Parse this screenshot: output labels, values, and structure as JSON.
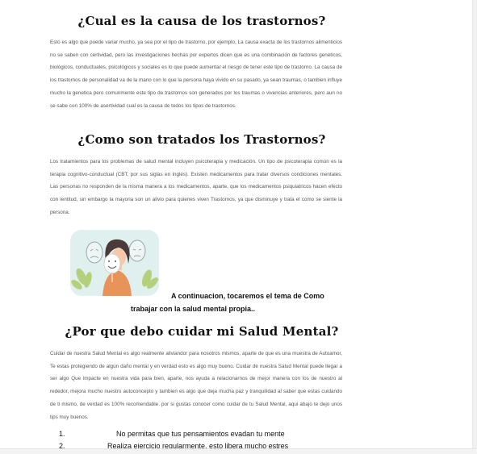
{
  "sections": [
    {
      "heading": "¿Cual es la causa de los trastornos?",
      "paragraph": "Esto es algo que puede variar mucho, ya sea por el tipo de trastorno, por ejemplo, La causa exacta de los trastornos alimenticios no se saben con certividad, pero las investigaciones hechas por expertos dicen que es una combinación de factores genéticos, biológicos, conductuales, psicológicos y sociales es lo que puede aumentar el riesgo de tener este tipo de trastorno. La causa de los trastornos de personalidad va de la mano con lo que la persona haya vivido en su pasado, ya sean traumas, o tambien influye mucho la genetica pero comunmente este tipo de trastornos son generados por los traumas o vivencias anteriores, pero aun no se sabe con 100% de asertividad cual es la causa de todos los tipos de trastornos."
    },
    {
      "heading": "¿Como son tratados los Trastornos?",
      "paragraph": "Los tratamientos para los problemas de salud mental incluyen psicoterapia y medicación. Un tipo de psicoterapia común es la terapia cognitivo-conductual (CBT, por sus siglas en inglés). Existen medicamentos para tratar diversos condiciones mentales. Las personas no responden de la misma manera a los medicamentos, aparte, que los medicamentos psiquiatricos hacen efecto con lentitud, sin embargo la mayoria son un alivio para quienes viven Trastornos, ya que disminuye y trata el como se siente la persona."
    },
    {
      "heading": "¿Por que debo cuidar mi Salud Mental?",
      "paragraph": "Cuidar de nuestra Salud Mental es algo realmente aliviandor para nosotros mismos, aparte de que es una muestra de Autoamor, Te estas protegiendo de algún daño mental y en verdad esto es algo muy bueno. Cuidar de nuestra Salud Mental puede llegar a ser algo Que impacte en nuestra vida para bien, aparte, nos ayuda a relacionarnos de mejor manera con los de nuestro al rededor, mejora mucho nuestro autoconcepto y tambien es algo que deja mucha paz y tranquilidad al saber que estas cuidando de ti mismo, de verdad es 100% recomendable. por si gustas conocer como cuidar de tu Salud Mental, aqui abajo te dejo unos tips muy buenos."
    }
  ],
  "note": {
    "line1": "A continuacion, tocaremos el tema de Como",
    "line2": "trabajar con la salud mental propia.."
  },
  "tips": [
    {
      "number": "1.",
      "text": "No permitas que tus pensamientos evadan tu mente"
    },
    {
      "number": "2.",
      "text": "Realiza ejercicio regularmente, esto libera mucho estres"
    }
  ],
  "colors": {
    "illustration_bg": "#dff0ee",
    "shirt": "#e8935a",
    "hair": "#4a3a3a",
    "plant": "#b5d07a"
  }
}
